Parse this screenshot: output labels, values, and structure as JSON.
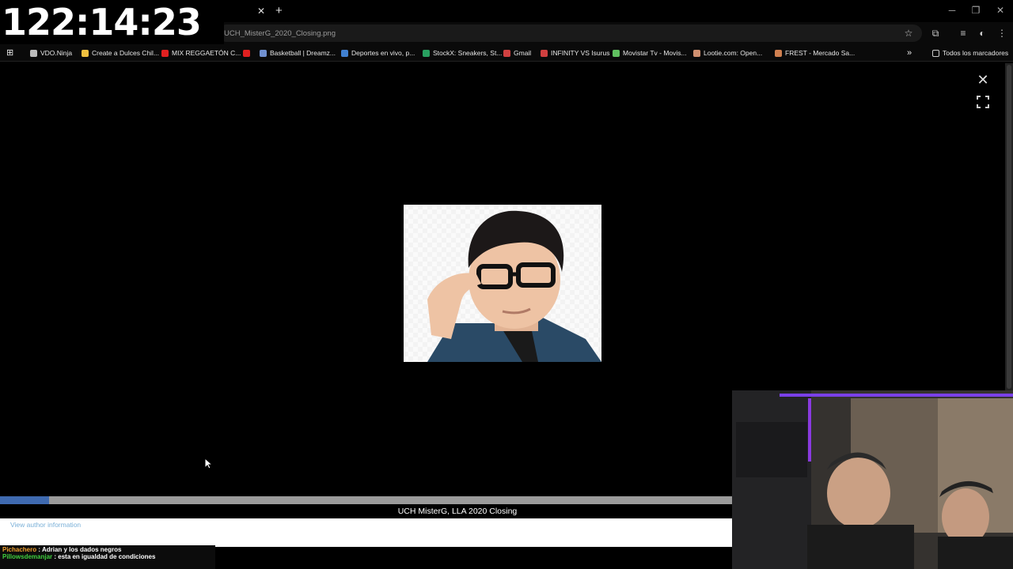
{
  "timer": "122:14:23",
  "tab": {
    "close_glyph": "✕",
    "new_tab_glyph": "+"
  },
  "window_controls": {
    "minimize": "─",
    "restore": "❐",
    "close": "✕"
  },
  "address": {
    "url": "UCH_MisterG_2020_Closing.png"
  },
  "bookmarks": [
    {
      "label": "VDO.Ninja",
      "color": "#bbbbbb"
    },
    {
      "label": "Create a Dulces Chil...",
      "color": "#f0c040"
    },
    {
      "label": "MIX REGGAETÓN C...",
      "color": "#e02020"
    },
    {
      "label": "",
      "color": "#e02020"
    },
    {
      "label": "Basketball | Dreamz...",
      "color": "#7090d0"
    },
    {
      "label": "Deportes en vivo, p...",
      "color": "#4080d0"
    },
    {
      "label": "StockX: Sneakers, St...",
      "color": "#28a060"
    },
    {
      "label": "Gmail",
      "color": "#d04040"
    },
    {
      "label": "INFINITY VS Isurus",
      "color": "#d04040"
    },
    {
      "label": "Movistar Tv - Movis...",
      "color": "#60c060"
    },
    {
      "label": "Lootie.com: Open...",
      "color": "#d09070"
    },
    {
      "label": "FREST - Mercado Sa...",
      "color": "#d08050"
    }
  ],
  "bookmarks_overflow": "»",
  "all_bookmarks": "Todos los marcadores",
  "viewer": {
    "close_glyph": "✕",
    "caption": "UCH MisterG, LLA 2020 Closing",
    "author_link": "View author information",
    "progress": 0.067
  },
  "chat": [
    {
      "user": "Pichachero",
      "user_color": "#f0a030",
      "message": "Adrian y los dados negros"
    },
    {
      "user": "Pillowsdemanjar",
      "user_color": "#40d040",
      "message": "esta en igualdad de condiciones"
    }
  ]
}
